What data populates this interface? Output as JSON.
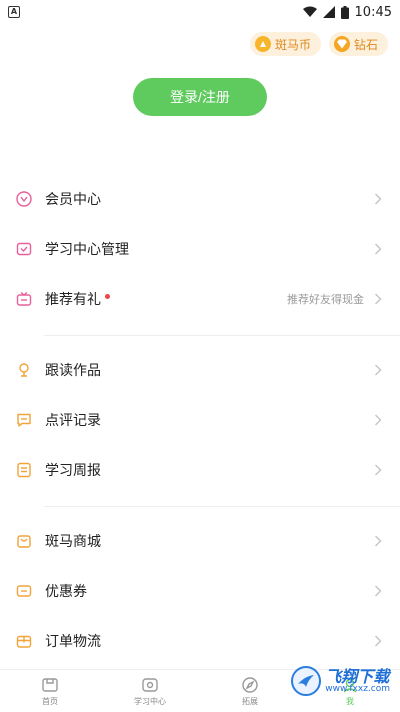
{
  "status_bar": {
    "left_icon_letter": "A",
    "time": "10:45"
  },
  "top_pills": [
    {
      "label": "斑马币",
      "icon": "zebra-coin-icon"
    },
    {
      "label": "钻石",
      "icon": "diamond-icon"
    }
  ],
  "login_button": "登录/注册",
  "menu_groups": [
    [
      {
        "label": "会员中心",
        "icon": "member-icon",
        "sub": "",
        "dot": false
      },
      {
        "label": "学习中心管理",
        "icon": "learning-manage-icon",
        "sub": "",
        "dot": false
      },
      {
        "label": "推荐有礼",
        "icon": "gift-tv-icon",
        "sub": "推荐好友得现金",
        "dot": true
      }
    ],
    [
      {
        "label": "跟读作品",
        "icon": "microphone-icon",
        "sub": "",
        "dot": false
      },
      {
        "label": "点评记录",
        "icon": "comment-icon",
        "sub": "",
        "dot": false
      },
      {
        "label": "学习周报",
        "icon": "report-icon",
        "sub": "",
        "dot": false
      }
    ],
    [
      {
        "label": "斑马商城",
        "icon": "shop-bag-icon",
        "sub": "",
        "dot": false
      },
      {
        "label": "优惠券",
        "icon": "coupon-icon",
        "sub": "",
        "dot": false
      },
      {
        "label": "订单物流",
        "icon": "box-icon",
        "sub": "",
        "dot": false
      }
    ]
  ],
  "tabbar": [
    {
      "label": "首页",
      "icon": "home-icon",
      "active": false
    },
    {
      "label": "学习中心",
      "icon": "study-center-icon",
      "active": false
    },
    {
      "label": "拓展",
      "icon": "explore-icon",
      "active": false
    },
    {
      "label": "我",
      "icon": "me-icon",
      "active": true
    }
  ],
  "watermark": {
    "cn": "飞翔下载",
    "en": "www.fxxz.com"
  },
  "colors": {
    "accent_green": "#5fcb5e",
    "icon_orange": "#f0a43a",
    "icon_pink": "#e8609a",
    "red_dot": "#ef4444"
  }
}
